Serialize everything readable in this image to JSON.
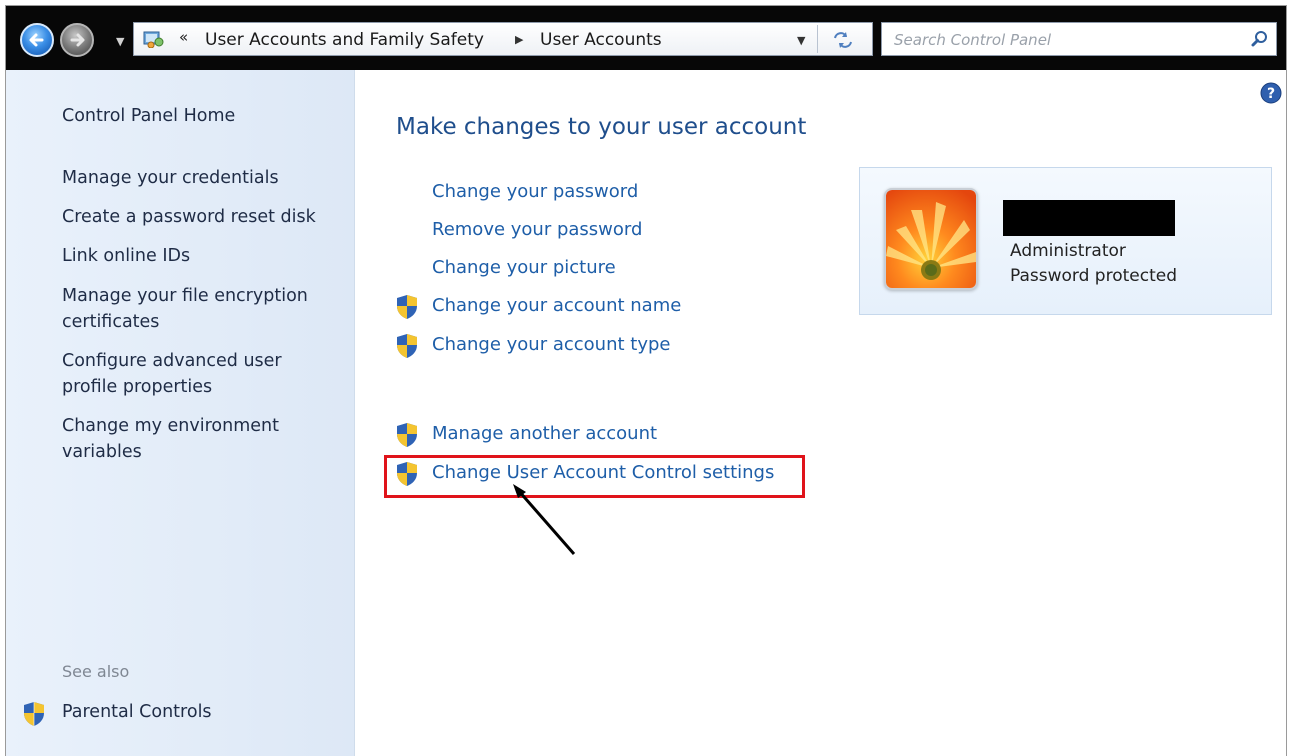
{
  "address_bar": {
    "overflow_chevron": "«",
    "breadcrumbs": [
      "User Accounts and Family Safety",
      "User Accounts"
    ],
    "search_placeholder": "Search Control Panel"
  },
  "left_nav": {
    "home": "Control Panel Home",
    "tasks": [
      "Manage your credentials",
      "Create a password reset disk",
      "Link online IDs",
      "Manage your file encryption certificates",
      "Configure advanced user profile properties",
      "Change my environment variables"
    ],
    "see_also_heading": "See also",
    "see_also_links": [
      "Parental Controls"
    ]
  },
  "main": {
    "title": "Make changes to your user account",
    "tasks": [
      {
        "label": "Change your password",
        "shield": false
      },
      {
        "label": "Remove your password",
        "shield": false
      },
      {
        "label": "Change your picture",
        "shield": false
      },
      {
        "label": "Change your account name",
        "shield": true
      },
      {
        "label": "Change your account type",
        "shield": true
      }
    ],
    "other_tasks": [
      {
        "label": "Manage another account",
        "shield": true
      },
      {
        "label": "Change User Account Control settings",
        "shield": true,
        "highlighted": true
      }
    ]
  },
  "account": {
    "role": "Administrator",
    "status": "Password protected"
  },
  "colors": {
    "link": "#1e5ea8",
    "title": "#1f4e8c",
    "highlight_box": "#e0131a",
    "nav_background": "#dde8f6"
  },
  "icons": [
    "back-arrow-icon",
    "forward-arrow-icon",
    "control-panel-icon",
    "refresh-icon",
    "search-icon",
    "help-icon",
    "uac-shield-icon",
    "user-picture-flower"
  ]
}
